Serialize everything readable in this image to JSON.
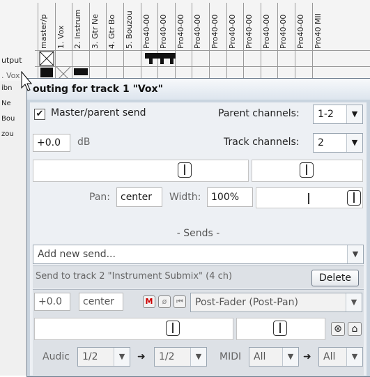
{
  "matrix": {
    "columns": [
      "master/p",
      "1. Vox",
      "2. Instrum",
      "3. Gtr Ne",
      "4. Gtr Bo",
      "5. Bouzou",
      "Pro40-00",
      "Pro40-00",
      "Pro40-00",
      "Pro40-00",
      "Pro40-00",
      "Pro40-00",
      "Pro40-00",
      "Pro40-00",
      "Pro40-00",
      "Pro40-00",
      "Pro40 MII"
    ],
    "row_output": "utput",
    "row_vox": ". Vox"
  },
  "leftlist": [
    "ibn",
    "Ne",
    "Bou",
    "zou"
  ],
  "window": {
    "title": "outing for track 1 \"Vox\"",
    "master_send_label": "Master/parent send",
    "master_send_checked": true,
    "check_mark": "✔",
    "parent_channels_label": "Parent channels:",
    "parent_channels_value": "1-2",
    "volume_value": "+0.0",
    "volume_unit": "dB",
    "track_channels_label": "Track channels:",
    "track_channels_value": "2",
    "pan_label": "Pan:",
    "pan_value": "center",
    "width_label": "Width:",
    "width_value": "100%",
    "sends_header": "- Sends -",
    "add_send_placeholder": "Add new send...",
    "send": {
      "title": "Send to track 2 \"Instrument Submix\" (4 ch)",
      "delete_label": "Delete",
      "volume": "+0.0",
      "pan": "center",
      "mute_label": "M",
      "mode_value": "Post-Fader (Post-Pan)",
      "audio_label": "Audic",
      "audio_src": "1/2",
      "audio_dst": "1/2",
      "midi_label": "MIDI",
      "midi_src": "All",
      "midi_dst": "All",
      "arrow": "➜"
    }
  },
  "icons": {
    "dropdown": "▼",
    "phase": "ø",
    "mono": "⏮",
    "env": "⊛",
    "home": "⌂"
  }
}
